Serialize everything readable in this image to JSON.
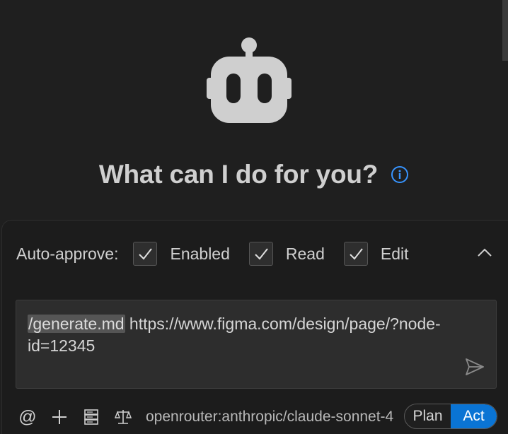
{
  "headline": {
    "title": "What can I do for you?"
  },
  "auto_approve": {
    "label": "Auto-approve:",
    "options": [
      {
        "label": "Enabled",
        "checked": true
      },
      {
        "label": "Read",
        "checked": true
      },
      {
        "label": "Edit",
        "checked": true
      }
    ]
  },
  "input": {
    "slash_command": "/generate.md",
    "text": " https://www.figma.com/design/page/?node-id=12345"
  },
  "bottom_bar": {
    "at_symbol": "@",
    "model": "openrouter:anthropic/claude-sonnet-4"
  },
  "mode_toggle": {
    "plan_label": "Plan",
    "act_label": "Act",
    "active": "Act"
  },
  "colors": {
    "accent": "#0a74d4",
    "info": "#3794ff",
    "robot": "#cfcfcf"
  },
  "icons": [
    "robot-icon",
    "info-icon",
    "check-icon",
    "chevron-up-icon",
    "send-icon",
    "at-icon",
    "plus-icon",
    "server-icon",
    "scale-icon"
  ]
}
